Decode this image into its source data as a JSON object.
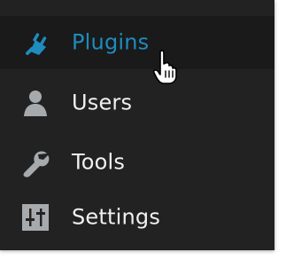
{
  "menu": {
    "items": [
      {
        "label": "Plugins",
        "icon": "plug-icon",
        "active": true
      },
      {
        "label": "Users",
        "icon": "user-icon",
        "active": false
      },
      {
        "label": "Tools",
        "icon": "wrench-icon",
        "active": false
      },
      {
        "label": "Settings",
        "icon": "sliders-icon",
        "active": false
      }
    ]
  },
  "colors": {
    "background": "#222222",
    "active_background": "#1a1a1a",
    "active_text": "#1e8cbe",
    "text": "#f1f1f1",
    "icon": "#a7aaad"
  },
  "cursor": {
    "icon": "hand-pointer-icon"
  }
}
